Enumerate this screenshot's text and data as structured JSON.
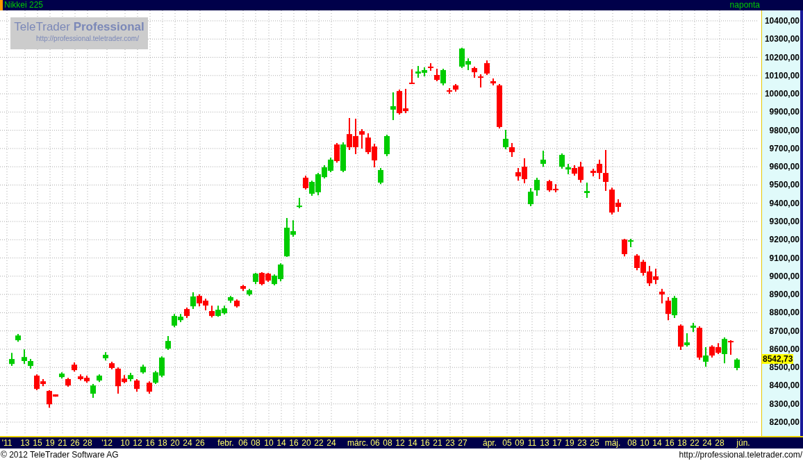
{
  "header": {
    "title": "Nikkei 225",
    "interval": "naponta"
  },
  "watermark": {
    "title": "TeleTrader **Professional**",
    "url": "http://professional.teletrader.com/"
  },
  "chart_data": {
    "type": "candlestick",
    "ylim": [
      8124,
      10457
    ],
    "grid": true,
    "yticks": [
      {
        "value": 10400,
        "label": "10400,00"
      },
      {
        "value": 10300,
        "label": "10300,00"
      },
      {
        "value": 10200,
        "label": "10200,00"
      },
      {
        "value": 10100,
        "label": "10100,00"
      },
      {
        "value": 10000,
        "label": "10000,00"
      },
      {
        "value": 9900,
        "label": "9900,00"
      },
      {
        "value": 9800,
        "label": "9800,00"
      },
      {
        "value": 9700,
        "label": "9700,00"
      },
      {
        "value": 9600,
        "label": "9600,00"
      },
      {
        "value": 9500,
        "label": "9500,00"
      },
      {
        "value": 9400,
        "label": "9400,00"
      },
      {
        "value": 9300,
        "label": "9300,00"
      },
      {
        "value": 9200,
        "label": "9200,00"
      },
      {
        "value": 9100,
        "label": "9100,00"
      },
      {
        "value": 9000,
        "label": "9000,00"
      },
      {
        "value": 8900,
        "label": "8900,00"
      },
      {
        "value": 8800,
        "label": "8800,00"
      },
      {
        "value": 8700,
        "label": "8700,00"
      },
      {
        "value": 8600,
        "label": "8600,00"
      },
      {
        "value": 8500,
        "label": "8500,00"
      },
      {
        "value": 8400,
        "label": "8400,00"
      },
      {
        "value": 8300,
        "label": "8300,00"
      },
      {
        "value": 8200,
        "label": "8200,00"
      }
    ],
    "ohlc": [
      [
        8519,
        8580,
        8508,
        8546
      ],
      [
        8649,
        8683,
        8641,
        8675
      ],
      [
        8535,
        8599,
        8519,
        8557
      ],
      [
        8508,
        8546,
        8493,
        8535
      ],
      [
        8455,
        8462,
        8375,
        8382
      ],
      [
        8424,
        8436,
        8397,
        8409
      ],
      [
        8371,
        8375,
        8279,
        8298
      ],
      [
        8352,
        8352,
        8340,
        8340
      ],
      [
        8447,
        8473,
        8439,
        8466
      ],
      [
        8436,
        8443,
        8394,
        8401
      ],
      [
        8515,
        8527,
        8477,
        8485
      ],
      [
        8451,
        8462,
        8428,
        8436
      ],
      [
        8443,
        8455,
        8416,
        8424
      ],
      [
        8356,
        8409,
        8333,
        8401
      ],
      [
        8428,
        8462,
        8420,
        8455
      ],
      [
        8550,
        8584,
        8538,
        8569
      ],
      [
        8523,
        8531,
        8489,
        8497
      ],
      [
        8493,
        8500,
        8356,
        8397
      ],
      [
        8439,
        8458,
        8413,
        8420
      ],
      [
        8436,
        8470,
        8424,
        8458
      ],
      [
        8428,
        8436,
        8367,
        8382
      ],
      [
        8473,
        8515,
        8466,
        8504
      ],
      [
        8416,
        8424,
        8356,
        8367
      ],
      [
        8416,
        8481,
        8409,
        8473
      ],
      [
        8455,
        8561,
        8447,
        8554
      ],
      [
        8603,
        8672,
        8596,
        8645
      ],
      [
        8729,
        8793,
        8721,
        8782
      ],
      [
        8759,
        8793,
        8748,
        8778
      ],
      [
        8820,
        8828,
        8771,
        8782
      ],
      [
        8835,
        8912,
        8820,
        8889
      ],
      [
        8892,
        8900,
        8835,
        8851
      ],
      [
        8866,
        8877,
        8813,
        8839
      ],
      [
        8809,
        8839,
        8774,
        8782
      ],
      [
        8782,
        8839,
        8778,
        8816
      ],
      [
        8797,
        8839,
        8790,
        8824
      ],
      [
        8866,
        8892,
        8854,
        8885
      ],
      [
        8866,
        8873,
        8828,
        8835
      ],
      [
        8946,
        8953,
        8919,
        8931
      ],
      [
        8900,
        8931,
        8892,
        8923
      ],
      [
        8969,
        9018,
        8957,
        9014
      ],
      [
        9018,
        9022,
        8950,
        8957
      ],
      [
        9014,
        9018,
        8969,
        8976
      ],
      [
        8957,
        9010,
        8950,
        9003
      ],
      [
        8984,
        9071,
        8972,
        9064
      ],
      [
        9109,
        9319,
        9106,
        9266
      ],
      [
        9227,
        9307,
        9216,
        9247
      ],
      [
        9380,
        9429,
        9372,
        9387
      ],
      [
        9540,
        9551,
        9475,
        9483
      ],
      [
        9452,
        9524,
        9441,
        9517
      ],
      [
        9460,
        9566,
        9444,
        9559
      ],
      [
        9543,
        9608,
        9536,
        9597
      ],
      [
        9578,
        9650,
        9570,
        9639
      ],
      [
        9722,
        9730,
        9623,
        9631
      ],
      [
        9578,
        9734,
        9570,
        9722
      ],
      [
        9779,
        9867,
        9692,
        9707
      ],
      [
        9768,
        9863,
        9669,
        9707
      ],
      [
        9795,
        9806,
        9700,
        9776
      ],
      [
        9760,
        9783,
        9669,
        9680
      ],
      [
        9711,
        9726,
        9597,
        9635
      ],
      [
        9513,
        9593,
        9505,
        9582
      ],
      [
        9669,
        9776,
        9658,
        9768
      ],
      [
        9913,
        10008,
        9856,
        9932
      ],
      [
        10015,
        10023,
        9886,
        9894
      ],
      [
        9920,
        10027,
        9894,
        9905
      ],
      [
        10061,
        10134,
        10054,
        10054
      ],
      [
        10111,
        10153,
        10088,
        10122
      ],
      [
        10115,
        10145,
        10095,
        10130
      ],
      [
        10149,
        10168,
        10126,
        10141
      ],
      [
        10103,
        10137,
        10069,
        10076
      ],
      [
        10057,
        10137,
        10046,
        10130
      ],
      [
        10019,
        10031,
        10000,
        10012
      ],
      [
        10046,
        10054,
        10012,
        10023
      ],
      [
        10149,
        10252,
        10141,
        10248
      ],
      [
        10160,
        10194,
        10130,
        10179
      ],
      [
        10141,
        10149,
        10088,
        10118
      ],
      [
        10095,
        10107,
        10035,
        10088
      ],
      [
        10168,
        10183,
        10103,
        10111
      ],
      [
        10069,
        10084,
        10046,
        10057
      ],
      [
        10046,
        10054,
        9810,
        9818
      ],
      [
        9707,
        9802,
        9696,
        9753
      ],
      [
        9707,
        9730,
        9654,
        9680
      ],
      [
        9570,
        9593,
        9524,
        9547
      ],
      [
        9600,
        9646,
        9509,
        9532
      ],
      [
        9395,
        9483,
        9384,
        9463
      ],
      [
        9471,
        9540,
        9441,
        9528
      ],
      [
        9616,
        9688,
        9600,
        9639
      ],
      [
        9521,
        9528,
        9463,
        9471
      ],
      [
        9479,
        9505,
        9460,
        9471
      ],
      [
        9600,
        9673,
        9589,
        9665
      ],
      [
        9585,
        9616,
        9559,
        9597
      ],
      [
        9593,
        9608,
        9551,
        9562
      ],
      [
        9600,
        9627,
        9513,
        9528
      ],
      [
        9456,
        9513,
        9429,
        9467
      ],
      [
        9578,
        9589,
        9547,
        9566
      ],
      [
        9616,
        9639,
        9532,
        9566
      ],
      [
        9566,
        9692,
        9467,
        9517
      ],
      [
        9475,
        9486,
        9338,
        9349
      ],
      [
        9403,
        9422,
        9353,
        9380
      ],
      [
        9201,
        9205,
        9109,
        9121
      ],
      [
        9189,
        9205,
        9159,
        9197
      ],
      [
        9113,
        9121,
        9033,
        9045
      ],
      [
        9079,
        9090,
        9003,
        9018
      ],
      [
        9026,
        9056,
        8946,
        8961
      ],
      [
        8999,
        9041,
        8957,
        8980
      ],
      [
        8915,
        8931,
        8851,
        8900
      ],
      [
        8866,
        8885,
        8759,
        8793
      ],
      [
        8786,
        8892,
        8771,
        8881
      ],
      [
        8729,
        8736,
        8596,
        8614
      ],
      [
        8622,
        8687,
        8614,
        8637
      ],
      [
        8717,
        8744,
        8694,
        8729
      ],
      [
        8717,
        8725,
        8542,
        8554
      ],
      [
        8531,
        8611,
        8504,
        8565
      ],
      [
        8614,
        8622,
        8554,
        8565
      ],
      [
        8611,
        8633,
        8573,
        8580
      ],
      [
        8573,
        8664,
        8523,
        8656
      ],
      [
        8645,
        8649,
        8569,
        8641
      ],
      [
        8497,
        8550,
        8485,
        8543
      ]
    ]
  },
  "last_price": "8542,73",
  "x_axis": {
    "labels": [
      "'11",
      "13",
      "15",
      "19",
      "21",
      "26",
      "28",
      "'12",
      "10",
      "12",
      "16",
      "18",
      "20",
      "24",
      "26",
      "febr.",
      "06",
      "08",
      "10",
      "14",
      "16",
      "20",
      "22",
      "24",
      "márc.",
      "06",
      "08",
      "12",
      "14",
      "16",
      "21",
      "23",
      "27",
      "ápr.",
      "05",
      "09",
      "11",
      "13",
      "17",
      "19",
      "23",
      "25",
      "máj.",
      "08",
      "10",
      "14",
      "16",
      "18",
      "22",
      "24",
      "28",
      "jún."
    ]
  },
  "footer": {
    "copyright": "© 2012 TeleTrader Software AG",
    "url": "http://professional.teletrader.com/"
  }
}
